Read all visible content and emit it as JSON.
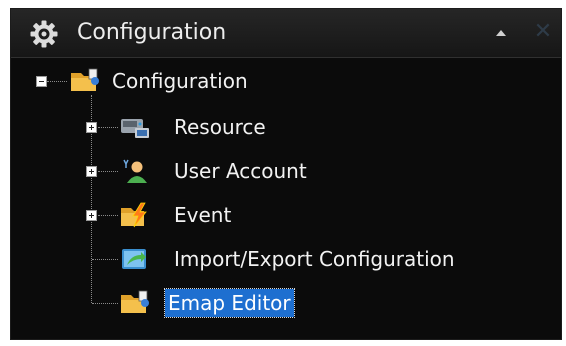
{
  "header": {
    "title": "Configuration",
    "icon": "gear-icon"
  },
  "tree": {
    "root": {
      "label": "Configuration",
      "icon": "folder-config-icon",
      "expanded": true
    },
    "children": [
      {
        "label": "Resource",
        "icon": "resource-icon",
        "expanded": false,
        "has_children": true
      },
      {
        "label": "User Account",
        "icon": "user-account-icon",
        "expanded": false,
        "has_children": true
      },
      {
        "label": "Event",
        "icon": "event-icon",
        "expanded": false,
        "has_children": true
      },
      {
        "label": "Import/Export Configuration",
        "icon": "import-export-icon",
        "has_children": false
      },
      {
        "label": "Emap Editor",
        "icon": "emap-editor-icon",
        "has_children": false,
        "selected": true
      }
    ]
  },
  "colors": {
    "panel_background": "#0b0b0b",
    "text": "#f2f2f2",
    "selection": "#1e6fd0"
  }
}
